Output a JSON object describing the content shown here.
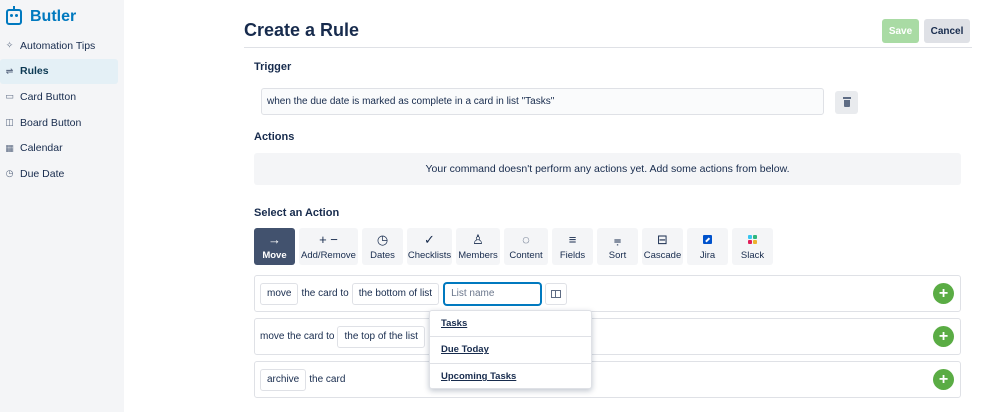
{
  "sidebar": {
    "brand": "Butler",
    "items": [
      {
        "label": "Automation Tips",
        "icon": "sparkle-icon",
        "active": false
      },
      {
        "label": "Rules",
        "icon": "sliders-icon",
        "active": true
      },
      {
        "label": "Card Button",
        "icon": "card-icon",
        "active": false
      },
      {
        "label": "Board Button",
        "icon": "board-icon",
        "active": false
      },
      {
        "label": "Calendar",
        "icon": "calendar-icon",
        "active": false
      },
      {
        "label": "Due Date",
        "icon": "clock-icon",
        "active": false
      }
    ]
  },
  "header": {
    "title": "Create a Rule",
    "save_label": "Save",
    "cancel_label": "Cancel"
  },
  "trigger": {
    "heading": "Trigger",
    "text": "when the due date is marked as complete in a card in list \"Tasks\""
  },
  "actions": {
    "heading": "Actions",
    "empty_message": "Your command doesn't perform any actions yet. Add some actions from below."
  },
  "select_action": {
    "heading": "Select an Action",
    "tools": [
      {
        "label": "Move",
        "icon": "arrow-right-icon",
        "active": true
      },
      {
        "label": "Add/Remove",
        "icon": "plus-minus-icon",
        "active": false
      },
      {
        "label": "Dates",
        "icon": "clock-icon",
        "active": false
      },
      {
        "label": "Checklists",
        "icon": "checkmark-icon",
        "active": false
      },
      {
        "label": "Members",
        "icon": "person-icon",
        "active": false
      },
      {
        "label": "Content",
        "icon": "comment-icon",
        "active": false
      },
      {
        "label": "Fields",
        "icon": "lines-icon",
        "active": false
      },
      {
        "label": "Sort",
        "icon": "sort-icon",
        "active": false
      },
      {
        "label": "Cascade",
        "icon": "cascade-icon",
        "active": false
      },
      {
        "label": "Jira",
        "icon": "jira-icon",
        "active": false
      },
      {
        "label": "Slack",
        "icon": "slack-icon",
        "active": false
      }
    ]
  },
  "rows": {
    "move": {
      "verb": "move",
      "text1": "the card to",
      "position": "the bottom of list",
      "input_placeholder": "List name"
    },
    "move_top": {
      "text1": "move the card to",
      "position": "the top of the list"
    },
    "archive": {
      "verb": "archive",
      "text1": "the card"
    },
    "add_symbol": "+"
  },
  "dropdown": {
    "options": [
      "Tasks",
      "Due Today",
      "Upcoming Tasks"
    ]
  },
  "colors": {
    "brand": "#0079bf",
    "save_bg": "#a9dba4",
    "add_green": "#5aac44",
    "active_tool": "#42526e"
  }
}
